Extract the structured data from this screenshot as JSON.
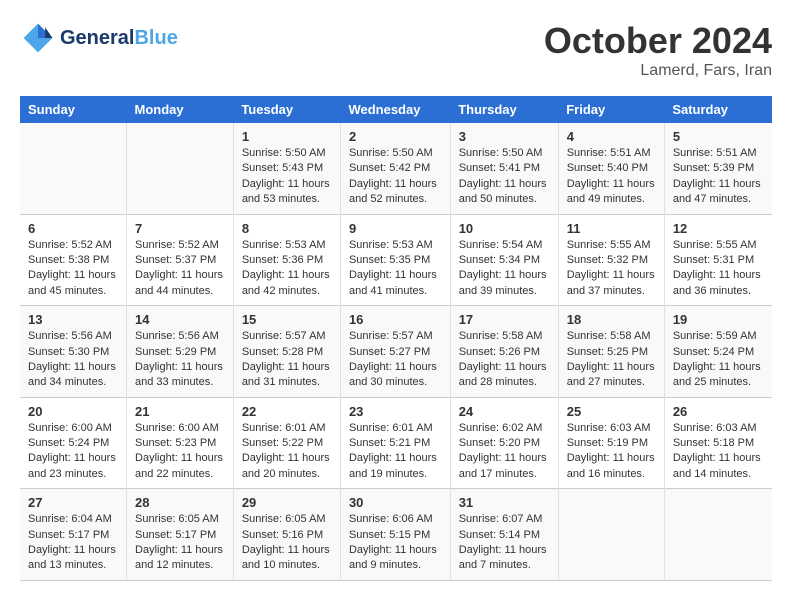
{
  "header": {
    "logo_line1": "General",
    "logo_line2": "Blue",
    "month": "October 2024",
    "location": "Lamerd, Fars, Iran"
  },
  "days_of_week": [
    "Sunday",
    "Monday",
    "Tuesday",
    "Wednesday",
    "Thursday",
    "Friday",
    "Saturday"
  ],
  "weeks": [
    [
      {
        "day": "",
        "info": ""
      },
      {
        "day": "",
        "info": ""
      },
      {
        "day": "1",
        "info": "Sunrise: 5:50 AM\nSunset: 5:43 PM\nDaylight: 11 hours and 53 minutes."
      },
      {
        "day": "2",
        "info": "Sunrise: 5:50 AM\nSunset: 5:42 PM\nDaylight: 11 hours and 52 minutes."
      },
      {
        "day": "3",
        "info": "Sunrise: 5:50 AM\nSunset: 5:41 PM\nDaylight: 11 hours and 50 minutes."
      },
      {
        "day": "4",
        "info": "Sunrise: 5:51 AM\nSunset: 5:40 PM\nDaylight: 11 hours and 49 minutes."
      },
      {
        "day": "5",
        "info": "Sunrise: 5:51 AM\nSunset: 5:39 PM\nDaylight: 11 hours and 47 minutes."
      }
    ],
    [
      {
        "day": "6",
        "info": "Sunrise: 5:52 AM\nSunset: 5:38 PM\nDaylight: 11 hours and 45 minutes."
      },
      {
        "day": "7",
        "info": "Sunrise: 5:52 AM\nSunset: 5:37 PM\nDaylight: 11 hours and 44 minutes."
      },
      {
        "day": "8",
        "info": "Sunrise: 5:53 AM\nSunset: 5:36 PM\nDaylight: 11 hours and 42 minutes."
      },
      {
        "day": "9",
        "info": "Sunrise: 5:53 AM\nSunset: 5:35 PM\nDaylight: 11 hours and 41 minutes."
      },
      {
        "day": "10",
        "info": "Sunrise: 5:54 AM\nSunset: 5:34 PM\nDaylight: 11 hours and 39 minutes."
      },
      {
        "day": "11",
        "info": "Sunrise: 5:55 AM\nSunset: 5:32 PM\nDaylight: 11 hours and 37 minutes."
      },
      {
        "day": "12",
        "info": "Sunrise: 5:55 AM\nSunset: 5:31 PM\nDaylight: 11 hours and 36 minutes."
      }
    ],
    [
      {
        "day": "13",
        "info": "Sunrise: 5:56 AM\nSunset: 5:30 PM\nDaylight: 11 hours and 34 minutes."
      },
      {
        "day": "14",
        "info": "Sunrise: 5:56 AM\nSunset: 5:29 PM\nDaylight: 11 hours and 33 minutes."
      },
      {
        "day": "15",
        "info": "Sunrise: 5:57 AM\nSunset: 5:28 PM\nDaylight: 11 hours and 31 minutes."
      },
      {
        "day": "16",
        "info": "Sunrise: 5:57 AM\nSunset: 5:27 PM\nDaylight: 11 hours and 30 minutes."
      },
      {
        "day": "17",
        "info": "Sunrise: 5:58 AM\nSunset: 5:26 PM\nDaylight: 11 hours and 28 minutes."
      },
      {
        "day": "18",
        "info": "Sunrise: 5:58 AM\nSunset: 5:25 PM\nDaylight: 11 hours and 27 minutes."
      },
      {
        "day": "19",
        "info": "Sunrise: 5:59 AM\nSunset: 5:24 PM\nDaylight: 11 hours and 25 minutes."
      }
    ],
    [
      {
        "day": "20",
        "info": "Sunrise: 6:00 AM\nSunset: 5:24 PM\nDaylight: 11 hours and 23 minutes."
      },
      {
        "day": "21",
        "info": "Sunrise: 6:00 AM\nSunset: 5:23 PM\nDaylight: 11 hours and 22 minutes."
      },
      {
        "day": "22",
        "info": "Sunrise: 6:01 AM\nSunset: 5:22 PM\nDaylight: 11 hours and 20 minutes."
      },
      {
        "day": "23",
        "info": "Sunrise: 6:01 AM\nSunset: 5:21 PM\nDaylight: 11 hours and 19 minutes."
      },
      {
        "day": "24",
        "info": "Sunrise: 6:02 AM\nSunset: 5:20 PM\nDaylight: 11 hours and 17 minutes."
      },
      {
        "day": "25",
        "info": "Sunrise: 6:03 AM\nSunset: 5:19 PM\nDaylight: 11 hours and 16 minutes."
      },
      {
        "day": "26",
        "info": "Sunrise: 6:03 AM\nSunset: 5:18 PM\nDaylight: 11 hours and 14 minutes."
      }
    ],
    [
      {
        "day": "27",
        "info": "Sunrise: 6:04 AM\nSunset: 5:17 PM\nDaylight: 11 hours and 13 minutes."
      },
      {
        "day": "28",
        "info": "Sunrise: 6:05 AM\nSunset: 5:17 PM\nDaylight: 11 hours and 12 minutes."
      },
      {
        "day": "29",
        "info": "Sunrise: 6:05 AM\nSunset: 5:16 PM\nDaylight: 11 hours and 10 minutes."
      },
      {
        "day": "30",
        "info": "Sunrise: 6:06 AM\nSunset: 5:15 PM\nDaylight: 11 hours and 9 minutes."
      },
      {
        "day": "31",
        "info": "Sunrise: 6:07 AM\nSunset: 5:14 PM\nDaylight: 11 hours and 7 minutes."
      },
      {
        "day": "",
        "info": ""
      },
      {
        "day": "",
        "info": ""
      }
    ]
  ]
}
